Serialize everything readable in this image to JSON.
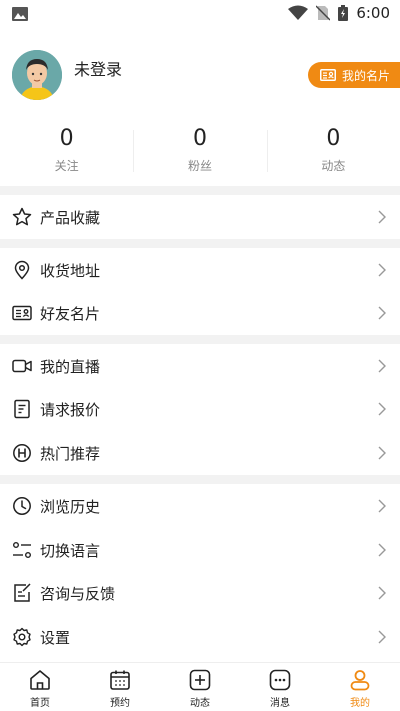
{
  "status_bar": {
    "time": "6:00"
  },
  "profile": {
    "username": "未登录",
    "card_button": "我的名片"
  },
  "stats": [
    {
      "value": "0",
      "label": "关注"
    },
    {
      "value": "0",
      "label": "粉丝"
    },
    {
      "value": "0",
      "label": "动态"
    }
  ],
  "menu": {
    "product_favorites": "产品收藏",
    "shipping_address": "收货地址",
    "friend_cards": "好友名片",
    "my_live": "我的直播",
    "request_quote": "请求报价",
    "hot_recommend": "热门推荐",
    "browse_history": "浏览历史",
    "switch_language": "切换语言",
    "feedback": "咨询与反馈",
    "settings": "设置"
  },
  "bottom_nav": [
    {
      "label": "首页",
      "icon": "home-icon"
    },
    {
      "label": "预约",
      "icon": "calendar-icon"
    },
    {
      "label": "动态",
      "icon": "plus-square-icon"
    },
    {
      "label": "消息",
      "icon": "message-icon"
    },
    {
      "label": "我的",
      "icon": "user-icon"
    }
  ],
  "colors": {
    "accent": "#f08a13",
    "divider": "#f2f2f2"
  }
}
